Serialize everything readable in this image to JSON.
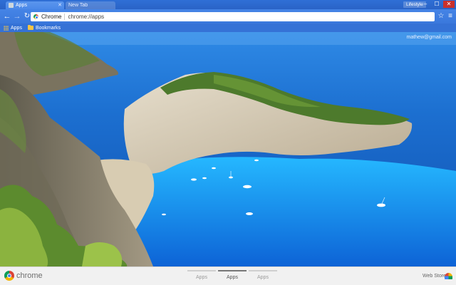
{
  "window": {
    "tabs": [
      {
        "label": "Apps",
        "active": true
      },
      {
        "label": "New Tab",
        "active": false
      }
    ],
    "profile_name": "Lifestyle",
    "controls": {
      "minimize": "–",
      "maximize": "☐",
      "close": "✕"
    }
  },
  "toolbar": {
    "omnibox_chip": "Chrome",
    "url": "chrome://apps",
    "icons": [
      "back-icon",
      "forward-icon",
      "reload-icon",
      "star-icon",
      "menu-icon"
    ]
  },
  "bookmarks": [
    {
      "label": "Apps",
      "icon": "apps-grid-icon"
    },
    {
      "label": "Bookmarks",
      "icon": "folder-icon"
    }
  ],
  "account_email": "mathew@gmail.com",
  "bottom": {
    "logo_text": "chrome",
    "page_tabs": [
      {
        "label": "Apps",
        "active": false
      },
      {
        "label": "Apps",
        "active": true
      },
      {
        "label": "Apps",
        "active": false
      }
    ],
    "webstore_label": "Web Store"
  },
  "colors": {
    "tab_bar": "#2f6fd6",
    "toolbar": "#3a78dc",
    "bookmark_bar": "#3572d6",
    "sea": "#1565c0",
    "lagoon": "#1aa0ff",
    "close_button": "#c9302c"
  }
}
